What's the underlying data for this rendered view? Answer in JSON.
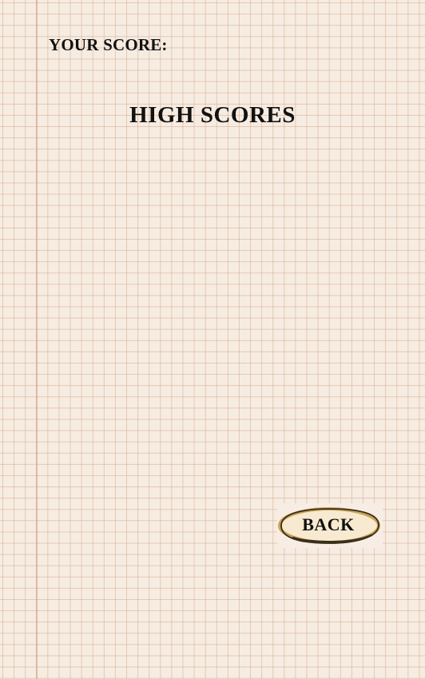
{
  "score_panel": {
    "label": "YOUR SCORE:"
  },
  "high_scores": {
    "title": "HIGH SCORES",
    "entries": []
  },
  "back_button": {
    "label": "BACK"
  },
  "colors": {
    "paper": "#f6ece2",
    "grid_line": "#d6aa8c",
    "text": "#111111",
    "button_fill": "#f8ead0",
    "button_outline": "#3a2f1c",
    "button_rim": "#c9a35a"
  }
}
